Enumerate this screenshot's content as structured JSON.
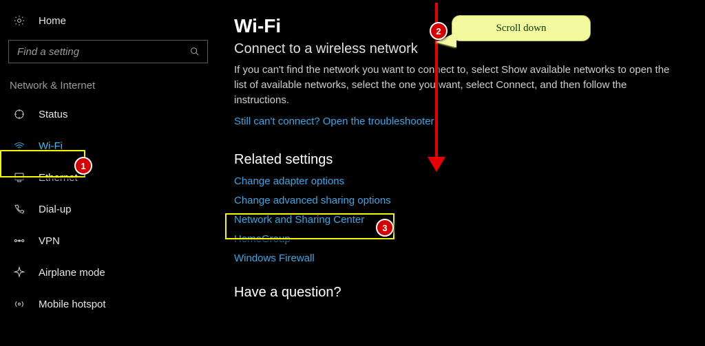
{
  "home_label": "Home",
  "search_placeholder": "Find a setting",
  "category": "Network & Internet",
  "nav": [
    {
      "label": "Status",
      "selected": false
    },
    {
      "label": "Wi-Fi",
      "selected": true
    },
    {
      "label": "Ethernet",
      "selected": false
    },
    {
      "label": "Dial-up",
      "selected": false
    },
    {
      "label": "VPN",
      "selected": false
    },
    {
      "label": "Airplane mode",
      "selected": false
    },
    {
      "label": "Mobile hotspot",
      "selected": false
    }
  ],
  "page_title": "Wi-Fi",
  "section1_title": "Connect to a wireless network",
  "section1_body": "If you can't find the network you want to connect to, select Show available networks to open the list of available networks, select the one you want, select Connect, and then follow the instructions.",
  "troubleshooter_link": "Still can't connect? Open the troubleshooter",
  "related_title": "Related settings",
  "related_links": [
    "Change adapter options",
    "Change advanced sharing options",
    "Network and Sharing Center",
    "HomeGroup",
    "Windows Firewall"
  ],
  "question_title": "Have a question?",
  "annotations": {
    "badge1": "1",
    "badge2": "2",
    "badge3": "3",
    "callout": "Scroll down"
  }
}
